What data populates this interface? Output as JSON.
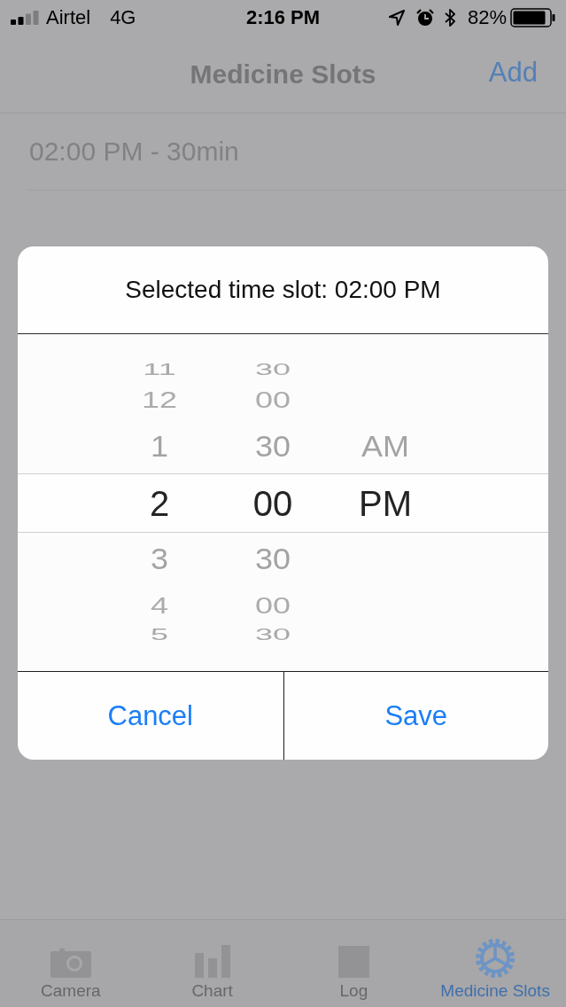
{
  "status_bar": {
    "carrier": "Airtel",
    "network": "4G",
    "time": "2:16 PM",
    "battery": "82%"
  },
  "nav_bar": {
    "title": "Medicine Slots",
    "action": "Add"
  },
  "slots": [
    {
      "label": "02:00 PM - 30min"
    }
  ],
  "dialog": {
    "title": "Selected time slot: 02:00 PM",
    "picker": {
      "columns": [
        {
          "items": [
            {
              "label": "11",
              "selected": false
            },
            {
              "label": "12",
              "selected": false
            },
            {
              "label": "1",
              "selected": false
            },
            {
              "label": "2",
              "selected": true
            },
            {
              "label": "3",
              "selected": false
            },
            {
              "label": "4",
              "selected": false
            },
            {
              "label": "5",
              "selected": false
            }
          ]
        },
        {
          "items": [
            {
              "label": "30",
              "selected": false
            },
            {
              "label": "00",
              "selected": false
            },
            {
              "label": "30",
              "selected": false
            },
            {
              "label": "00",
              "selected": true
            },
            {
              "label": "30",
              "selected": false
            },
            {
              "label": "00",
              "selected": false
            },
            {
              "label": "30",
              "selected": false
            }
          ]
        },
        {
          "items": [
            {
              "label": "AM",
              "selected": false
            },
            {
              "label": "PM",
              "selected": true
            }
          ]
        }
      ]
    },
    "buttons": [
      {
        "label": "Cancel"
      },
      {
        "label": "Save"
      }
    ]
  },
  "tab_bar": {
    "tabs": [
      {
        "label": "Camera",
        "kind": "camera",
        "selected": false
      },
      {
        "label": "Chart",
        "kind": "chart",
        "selected": false
      },
      {
        "label": "Log",
        "kind": "log",
        "selected": false
      },
      {
        "label": "Medicine Slots",
        "kind": "gear",
        "selected": true
      }
    ]
  }
}
